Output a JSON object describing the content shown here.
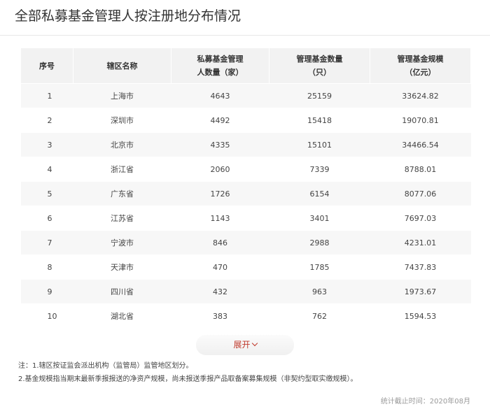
{
  "title": "全部私募基金管理人按注册地分布情况",
  "table": {
    "headers": {
      "index": "序号",
      "region": "辖区名称",
      "managers_line1": "私募基金管理",
      "managers_line2": "人数量（家）",
      "funds_line1": "管理基金数量",
      "funds_line2": "（只）",
      "scale_line1": "管理基金规模",
      "scale_line2": "（亿元）"
    },
    "rows": [
      {
        "index": "1",
        "region": "上海市",
        "managers": "4643",
        "funds": "25159",
        "scale": "33624.82"
      },
      {
        "index": "2",
        "region": "深圳市",
        "managers": "4492",
        "funds": "15418",
        "scale": "19070.81"
      },
      {
        "index": "3",
        "region": "北京市",
        "managers": "4335",
        "funds": "15101",
        "scale": "34466.54"
      },
      {
        "index": "4",
        "region": "浙江省",
        "managers": "2060",
        "funds": "7339",
        "scale": "8788.01"
      },
      {
        "index": "5",
        "region": "广东省",
        "managers": "1726",
        "funds": "6154",
        "scale": "8077.06"
      },
      {
        "index": "6",
        "region": "江苏省",
        "managers": "1143",
        "funds": "3401",
        "scale": "7697.03"
      },
      {
        "index": "7",
        "region": "宁波市",
        "managers": "846",
        "funds": "2988",
        "scale": "4231.01"
      },
      {
        "index": "8",
        "region": "天津市",
        "managers": "470",
        "funds": "1785",
        "scale": "7437.83"
      },
      {
        "index": "9",
        "region": "四川省",
        "managers": "432",
        "funds": "963",
        "scale": "1973.67"
      },
      {
        "index": "10",
        "region": "湖北省",
        "managers": "383",
        "funds": "762",
        "scale": "1594.53"
      }
    ]
  },
  "expand_label": "展开",
  "notes": {
    "line1": "注：1.辖区按证监会派出机构（监管局）监管地区划分。",
    "line2": "2.基金规模指当期末最新季报报送的净资产规模，尚未报送季报产品取备案募集规模（非契约型取实缴规模）。"
  },
  "footer": "统计截止时间：2020年08月",
  "colors": {
    "accent": "#c0392b",
    "header_bg": "#f2f2f2",
    "stripe_bg": "#f7f7f7"
  }
}
